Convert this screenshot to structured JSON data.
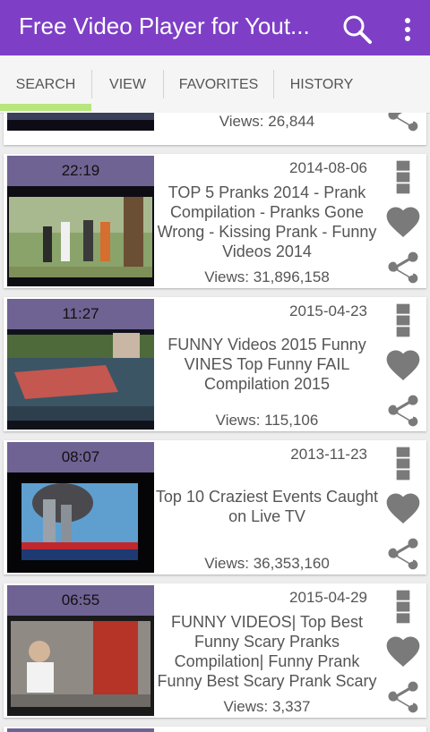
{
  "app": {
    "title": "Free Video Player for Yout..."
  },
  "icons": {
    "search": "search-icon",
    "more": "more-vert-icon",
    "menu": "more-vert-icon",
    "favorite": "heart-icon",
    "share": "share-icon"
  },
  "colors": {
    "appbar": "#7e3fc6",
    "tab_indicator": "#b7e67d",
    "duration_band": "#6f6393",
    "icon": "#777777"
  },
  "tabs": [
    {
      "label": "SEARCH",
      "selected": true
    },
    {
      "label": "VIEW",
      "selected": false
    },
    {
      "label": "FAVORITES",
      "selected": false
    },
    {
      "label": "HISTORY",
      "selected": false
    }
  ],
  "videos": [
    {
      "views": "Views: 26,844"
    },
    {
      "duration": "22:19",
      "date": "2014-08-06",
      "title": "TOP 5 Pranks 2014 - Prank Compilation - Pranks Gone Wrong - Kissing Prank - Funny Videos 2014",
      "views": "Views: 31,896,158"
    },
    {
      "duration": "11:27",
      "date": "2015-04-23",
      "title": "FUNNY Videos 2015 Funny VINES Top Funny FAIL Compilation 2015",
      "views": "Views: 115,106"
    },
    {
      "duration": "08:07",
      "date": "2013-11-23",
      "title": "Top 10 Craziest Events Caught on Live TV",
      "views": "Views: 36,353,160"
    },
    {
      "duration": "06:55",
      "date": "2015-04-29",
      "title": "FUNNY VIDEOS| Top Best Funny Scary Pranks Compilation| Funny Prank Funny Best Scary Prank Scary",
      "views": "Views: 3,337"
    }
  ]
}
